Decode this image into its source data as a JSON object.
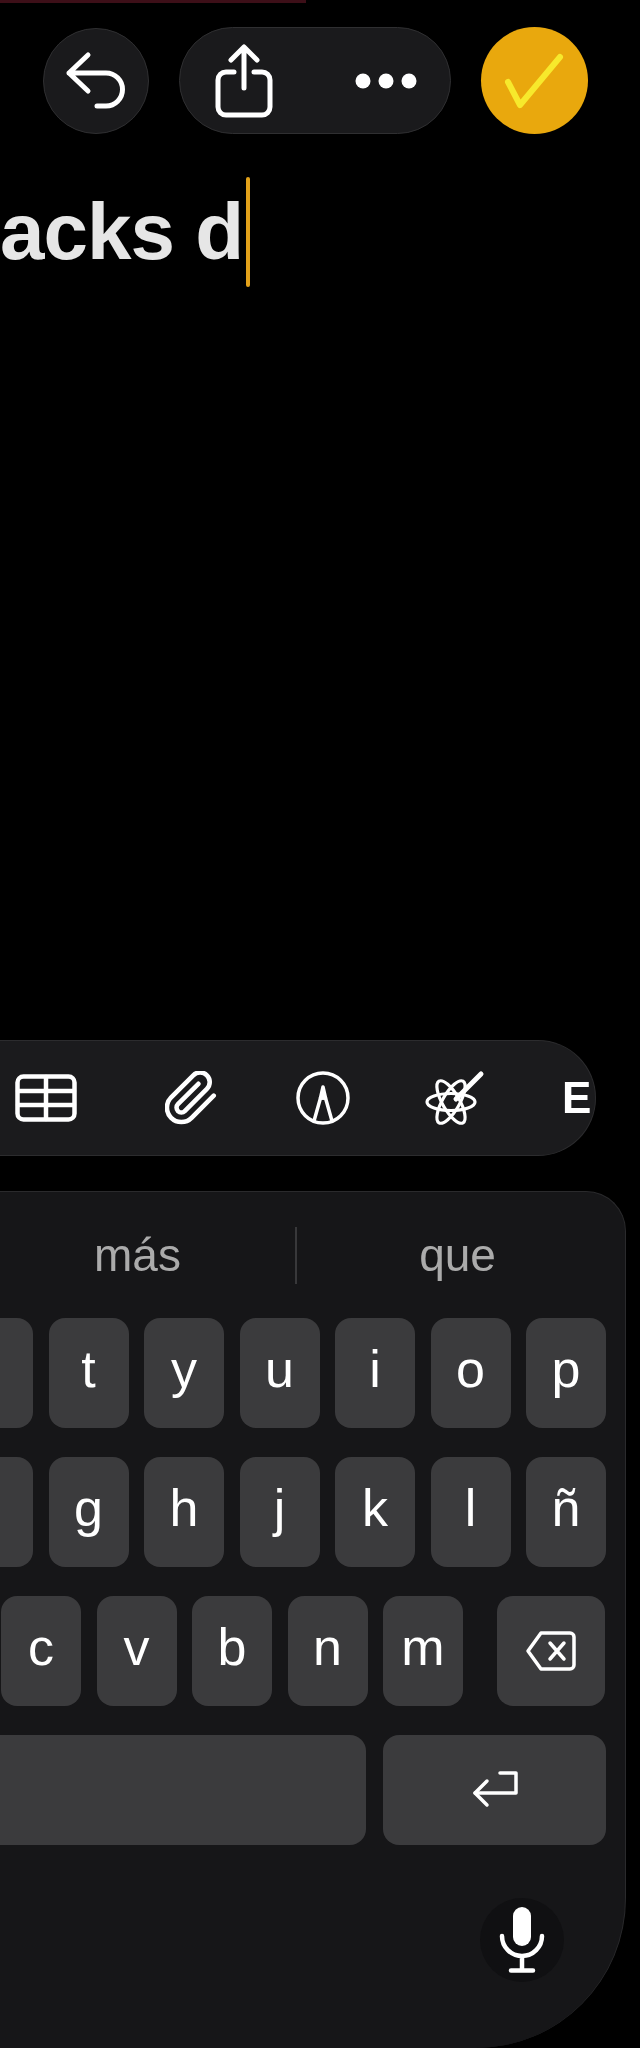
{
  "note": {
    "text": "acks d",
    "caret": true
  },
  "toolbar": {
    "cut_off_label": "E"
  },
  "keyboard": {
    "suggestions": [
      {
        "text": "más"
      },
      {
        "text": "que"
      }
    ],
    "rows": [
      [
        {
          "kind": "clipped"
        },
        {
          "kind": "letter",
          "label": "t"
        },
        {
          "kind": "letter",
          "label": "y"
        },
        {
          "kind": "letter",
          "label": "u"
        },
        {
          "kind": "letter",
          "label": "i"
        },
        {
          "kind": "letter",
          "label": "o"
        },
        {
          "kind": "letter",
          "label": "p"
        }
      ],
      [
        {
          "kind": "clipped"
        },
        {
          "kind": "letter",
          "label": "g"
        },
        {
          "kind": "letter",
          "label": "h"
        },
        {
          "kind": "letter",
          "label": "j"
        },
        {
          "kind": "letter",
          "label": "k"
        },
        {
          "kind": "letter",
          "label": "l"
        },
        {
          "kind": "letter",
          "label": "ñ"
        }
      ],
      [
        {
          "kind": "letter",
          "label": "c"
        },
        {
          "kind": "letter",
          "label": "v"
        },
        {
          "kind": "letter",
          "label": "b"
        },
        {
          "kind": "letter",
          "label": "n"
        },
        {
          "kind": "letter",
          "label": "m"
        },
        {
          "kind": "backspace"
        }
      ],
      [
        {
          "kind": "space"
        },
        {
          "kind": "return"
        }
      ]
    ]
  }
}
